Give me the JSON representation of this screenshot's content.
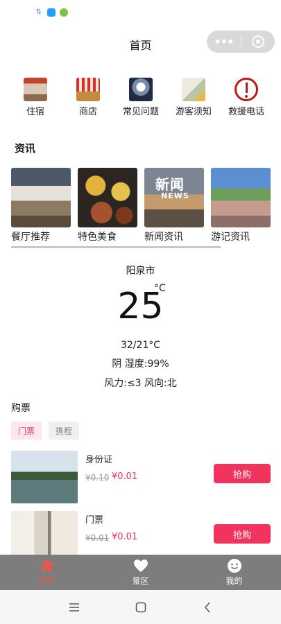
{
  "header": {
    "title": "首页"
  },
  "quick_nav": [
    {
      "label": "住宿",
      "icon": "lodging-photo-icon"
    },
    {
      "label": "商店",
      "icon": "shop-photo-icon"
    },
    {
      "label": "常见问题",
      "icon": "faq-photo-icon"
    },
    {
      "label": "游客须知",
      "icon": "notice-photo-icon"
    },
    {
      "label": "救援电话",
      "icon": "exclamation-circle-icon"
    }
  ],
  "news": {
    "heading": "资讯",
    "items": [
      {
        "label": "餐厅推荐"
      },
      {
        "label": "特色美食"
      },
      {
        "label": "新闻资讯",
        "image_text": "新闻",
        "image_subtext": "NEWS"
      },
      {
        "label": "游记资讯"
      }
    ]
  },
  "weather": {
    "city": "阳泉市",
    "temp": "25",
    "unit": "°C",
    "range": "32/21°C",
    "condition": "阴 湿度:99%",
    "wind": "风力:≤3 风向:北"
  },
  "tickets": {
    "heading": "购票",
    "tabs": [
      {
        "label": "门票",
        "active": true
      },
      {
        "label": "携程",
        "active": false
      }
    ],
    "products": [
      {
        "name": "身份证",
        "old_price": "¥0.10",
        "price": "¥0.01",
        "button": "抢购"
      },
      {
        "name": "门票",
        "old_price": "¥0.01",
        "price": "¥0.01",
        "button": "抢购"
      }
    ]
  },
  "tabbar": [
    {
      "label": "首页",
      "icon": "home-icon",
      "active": true
    },
    {
      "label": "景区",
      "icon": "heart-icon",
      "active": false
    },
    {
      "label": "我的",
      "icon": "smiley-icon",
      "active": false
    }
  ],
  "colors": {
    "accent": "#f2335e",
    "tab_active": "#e8584a",
    "tabbar_bg": "#7d7d7d",
    "tag_active_bg": "#fde6ec"
  }
}
